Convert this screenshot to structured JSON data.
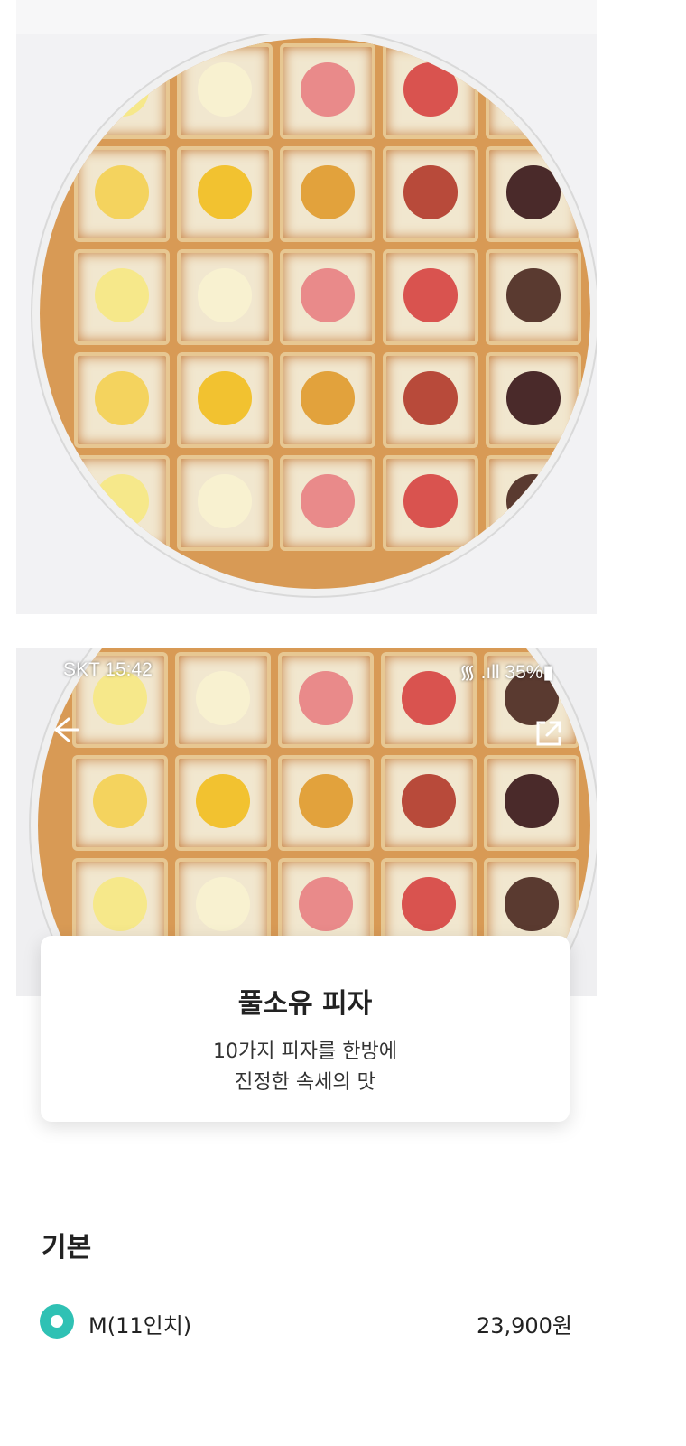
{
  "status_bar": {
    "carrier_time": "SKT 15:42",
    "signal_battery": "᯾ .ıll 35%▮"
  },
  "product": {
    "name": "풀소유 피자",
    "description_line1": "10가지 피자를 한방에",
    "description_line2": "진정한 속세의 맛"
  },
  "options": {
    "section_title": "기본",
    "items": [
      {
        "label": "M(11인치)",
        "price": "23,900원",
        "selected": true
      }
    ]
  },
  "colors": {
    "accent": "#2fc1b4"
  },
  "icons": {
    "back": "back-arrow-icon",
    "share": "share-icon",
    "radio": "radio-selected-icon"
  }
}
